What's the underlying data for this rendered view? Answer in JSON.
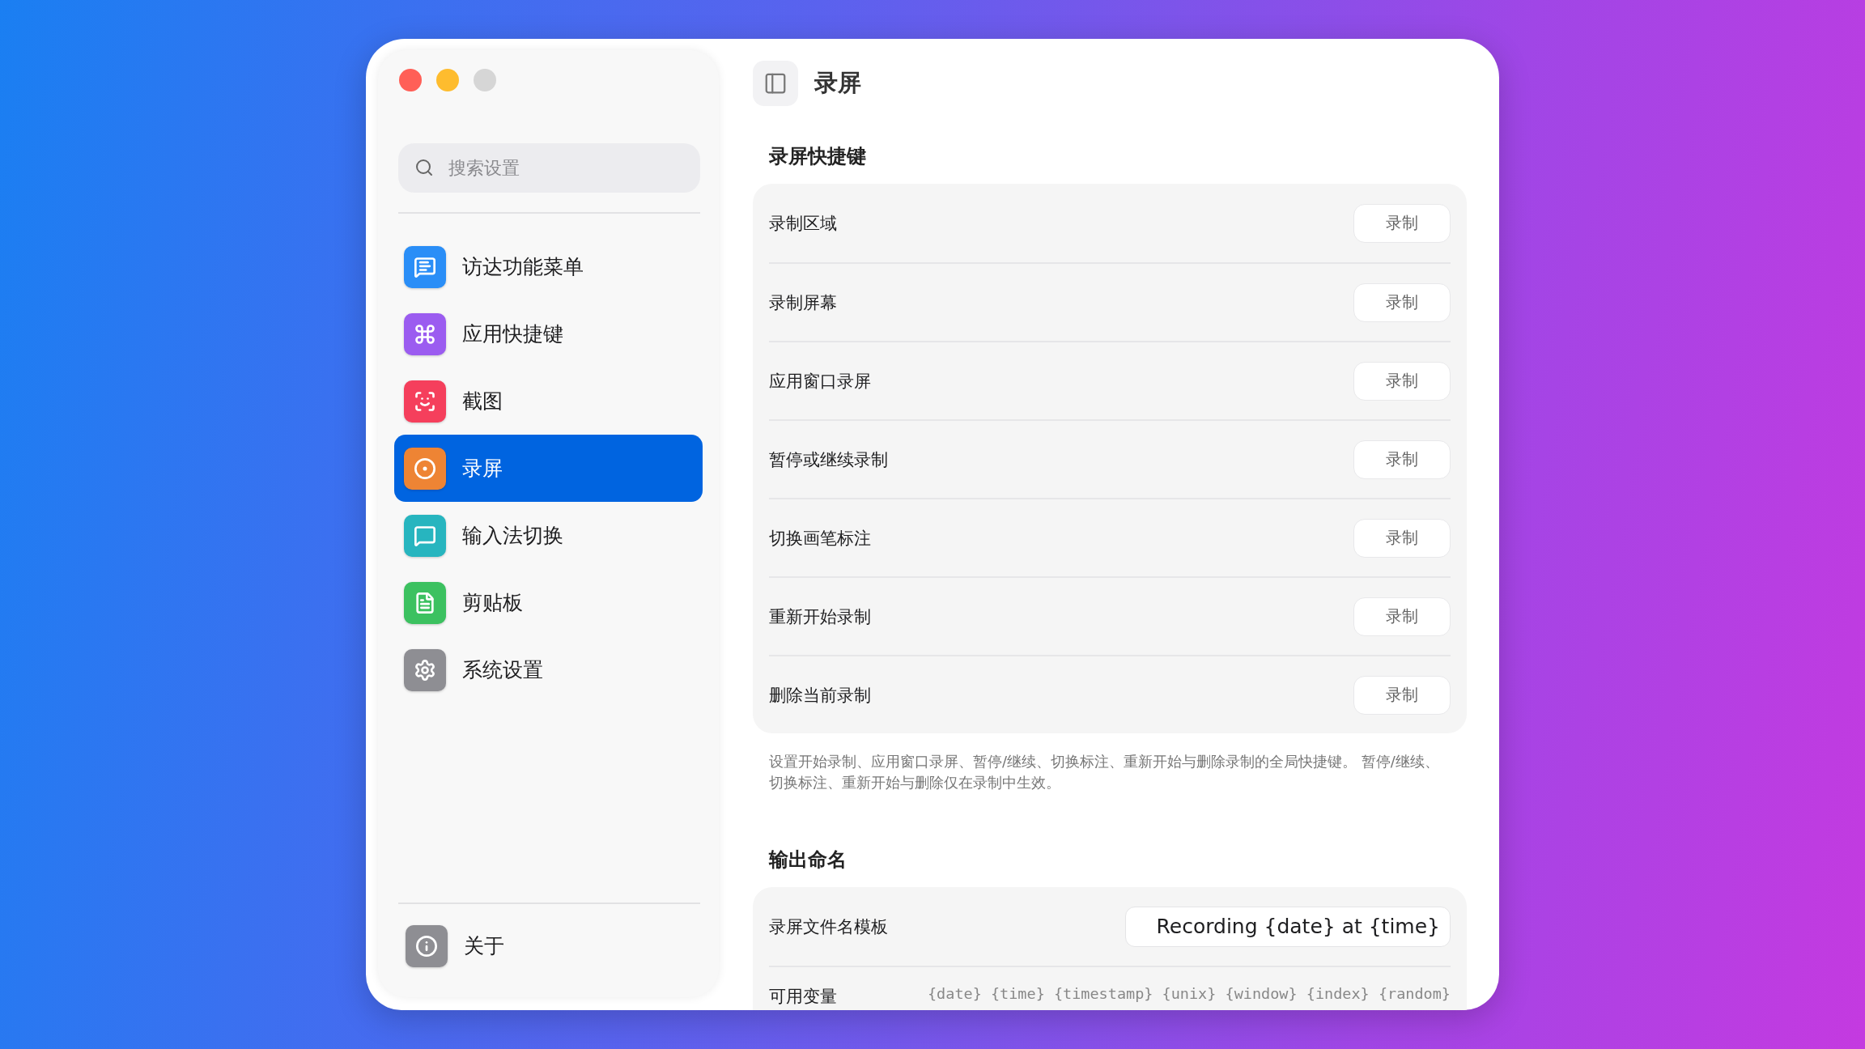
{
  "sidebar": {
    "search": {
      "placeholder": "搜索设置"
    },
    "items": [
      {
        "label": "访达功能菜单",
        "kind": "menu",
        "color": "#2a8ef7",
        "selected": false
      },
      {
        "label": "应用快捷键",
        "kind": "command",
        "color": "#9b5cf0",
        "selected": false
      },
      {
        "label": "截图",
        "kind": "screenshot",
        "color": "#f53f5c",
        "selected": false
      },
      {
        "label": "录屏",
        "kind": "record",
        "color": "#ee8434",
        "selected": true
      },
      {
        "label": "输入法切换",
        "kind": "input",
        "color": "#27b5bf",
        "selected": false
      },
      {
        "label": "剪贴板",
        "kind": "clipboard",
        "color": "#3cc160",
        "selected": false
      },
      {
        "label": "系统设置",
        "kind": "settings",
        "color": "#8e8e93",
        "selected": false
      }
    ],
    "footer": {
      "label": "关于",
      "kind": "info",
      "color": "#8e8e93"
    }
  },
  "header": {
    "title": "录屏"
  },
  "sections": [
    {
      "title": "录屏快捷键",
      "rows": [
        {
          "label": "录制区域",
          "kind": "shortcut",
          "button": "录制"
        },
        {
          "label": "录制屏幕",
          "kind": "shortcut",
          "button": "录制"
        },
        {
          "label": "应用窗口录屏",
          "kind": "shortcut",
          "button": "录制"
        },
        {
          "label": "暂停或继续录制",
          "kind": "shortcut",
          "button": "录制"
        },
        {
          "label": "切换画笔标注",
          "kind": "shortcut",
          "button": "录制"
        },
        {
          "label": "重新开始录制",
          "kind": "shortcut",
          "button": "录制"
        },
        {
          "label": "删除当前录制",
          "kind": "shortcut",
          "button": "录制"
        }
      ],
      "note": "设置开始录制、应用窗口录屏、暂停/继续、切换标注、重新开始与删除录制的全局快捷键。 暂停/继续、切换标注、重新开始与删除仅在录制中生效。"
    },
    {
      "title": "输出命名",
      "rows": [
        {
          "label": "录屏文件名模板",
          "kind": "field",
          "value": "Recording {date} at {time}"
        },
        {
          "label": "可用变量",
          "kind": "variables",
          "value": "{date} {time} {timestamp} {unix} {window} {index} {random}"
        }
      ]
    }
  ]
}
